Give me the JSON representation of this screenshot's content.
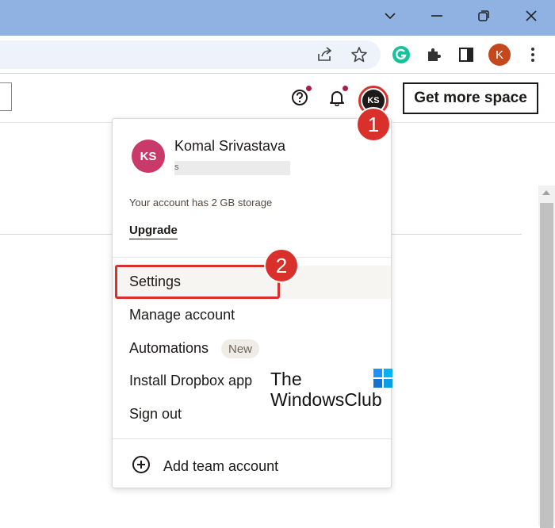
{
  "colors": {
    "titlebar": "#8fb2e3",
    "accent_red": "#d9302c",
    "avatar_pink": "#c93a6b",
    "notif_dot": "#a3204d"
  },
  "browser": {
    "icons": [
      "chevron-down-icon",
      "minimize-icon",
      "restore-icon",
      "close-icon",
      "share-icon",
      "star-icon",
      "grammarly-icon",
      "extensions-icon",
      "sidepanel-icon",
      "more-icon"
    ],
    "profile_initial": "K"
  },
  "header": {
    "avatar_initials": "KS",
    "get_more_space_label": "Get more space"
  },
  "dropdown": {
    "avatar_initials": "KS",
    "user_name": "Komal Srivastava",
    "email_prefix": "s",
    "storage_text": "Your account has 2 GB storage",
    "upgrade_label": "Upgrade",
    "menu": {
      "settings": "Settings",
      "manage_account": "Manage account",
      "automations": "Automations",
      "automations_badge": "New",
      "install_app": "Install Dropbox app",
      "sign_out": "Sign out"
    },
    "add_team_account": "Add team account"
  },
  "annotations": {
    "step1": "1",
    "step2": "2"
  },
  "watermark": {
    "line1": "The",
    "line2": "WindowsClub"
  }
}
